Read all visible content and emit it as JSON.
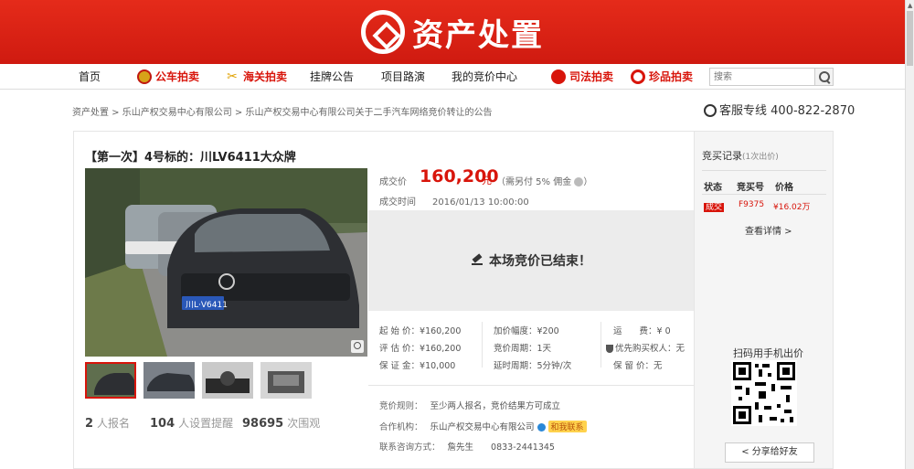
{
  "brand": {
    "logo_text": "资产处置"
  },
  "nav": {
    "items": [
      {
        "label": "首页",
        "red": false,
        "icon": ""
      },
      {
        "label": "公车拍卖",
        "red": true,
        "icon": "emblem-icon"
      },
      {
        "label": "海关拍卖",
        "red": true,
        "icon": "customs-icon"
      },
      {
        "label": "挂牌公告",
        "red": false,
        "icon": ""
      },
      {
        "label": "项目路演",
        "red": false,
        "icon": ""
      },
      {
        "label": "我的竞价中心",
        "red": false,
        "icon": ""
      },
      {
        "label": "司法拍卖",
        "red": true,
        "icon": "court-icon"
      },
      {
        "label": "珍品拍卖",
        "red": true,
        "icon": "treasure-icon"
      }
    ],
    "search_placeholder": "搜索"
  },
  "breadcrumb": {
    "items": [
      "资产处置",
      "乐山产权交易中心有限公司",
      "乐山产权交易中心有限公司关于二手汽车网络竞价转让的公告"
    ],
    "separator": " > "
  },
  "hotline": {
    "label": "客服专线",
    "number": "400-822-2870"
  },
  "lot": {
    "title": "【第一次】4号标的：川LV6411大众牌",
    "plate_text": "川L·V6411",
    "deal_price_label": "成交价",
    "deal_price": "160,200",
    "price_unit": "元",
    "fee_note": "（需另付 5% 佣金",
    "deal_time_label": "成交时间",
    "deal_time": "2016/01/13 10:00:00",
    "ended_text": "本场竞价已结束！",
    "params": {
      "start_price": "起 始 价：¥160,200",
      "increment": "加价幅度：¥200",
      "freight": "运　　费：¥ 0",
      "appraisal": "评 估 价：¥160,200",
      "cycle": "竞价周期：1天",
      "priority": "优先购买权人：无",
      "deposit": "保 证 金：¥10,000",
      "delay": "延时周期：5分钟/次",
      "reserve": "保 留 价：无"
    },
    "rule_label": "竞价规则：",
    "rule": "至少两人报名，竞价结果方可成立",
    "org_label": "合作机构：",
    "org": "乐山产权交易中心有限公司",
    "contact_badge": "和我联系",
    "consult_label": "联系咨询方式：",
    "consult_person": "詹先生",
    "consult_phone": "0833-2441345",
    "stats": {
      "signup_count": "2",
      "signup_label": "人报名",
      "remind_count": "104",
      "remind_label": "人设置提醒",
      "view_count": "98695",
      "view_label": "次围观"
    }
  },
  "record": {
    "title": "竞买记录",
    "count_note": "(1次出价)",
    "headers": [
      "状态",
      "竞买号",
      "价格"
    ],
    "rows": [
      {
        "status": "成交",
        "bidder": "F9375",
        "price": "¥16.02万"
      }
    ],
    "more": "查看详情 >",
    "scan_label": "扫码用手机出价",
    "share_label": "分享给好友"
  },
  "colors": {
    "brand_red": "#d8150b",
    "banner_red": "#e52b1a"
  }
}
